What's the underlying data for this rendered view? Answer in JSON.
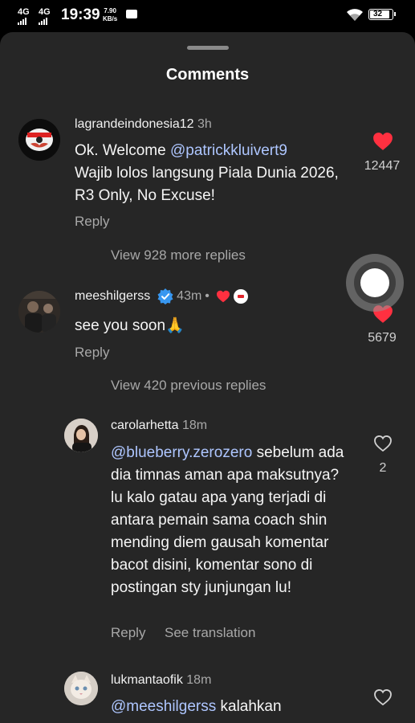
{
  "status_bar": {
    "net1": "4G",
    "net2": "4G",
    "time": "19:39",
    "speed_value": "7.90",
    "speed_unit": "KB/s",
    "battery": "32",
    "icons": [
      "signal-icon",
      "mail-icon",
      "wifi-icon",
      "battery-icon"
    ]
  },
  "sheet": {
    "title": "Comments"
  },
  "comments": [
    {
      "username": "lagrandeindonesia12",
      "time": "3h",
      "mention": "@patrickkluivert9",
      "text_before": "Ok. Welcome ",
      "text_after": "Wajib lolos langsung Piala Dunia 2026, R3 Only, No Excuse!",
      "reply": "Reply",
      "likes": "12447",
      "liked": true,
      "view_replies": "View 928 more replies"
    },
    {
      "username": "meeshilgerss",
      "time": "43m",
      "verified": true,
      "text": "see you soon🙏",
      "reply": "Reply",
      "likes": "5679",
      "liked": true,
      "view_replies": "View 420 previous replies"
    },
    {
      "username": "carolarhetta",
      "time": "18m",
      "mention": "@blueberry.zerozero",
      "text": "sebelum ada dia timnas aman apa maksutnya? lu kalo gatau apa yang terjadi di antara pemain sama coach shin mending diem gausah komentar bacot disini, komentar sono di postingan sty junjungan lu!",
      "reply": "Reply",
      "see_translation": "See translation",
      "likes": "2",
      "liked": false
    },
    {
      "username": "lukmantaofik",
      "time": "18m",
      "mention": "@meeshilgerss",
      "text": "kalahkan",
      "liked": false
    }
  ],
  "colors": {
    "sheet_bg": "#262626",
    "mention": "#aec6ff",
    "like_red": "#ff3040",
    "verify_blue": "#3897f0",
    "secondary_text": "#a8a8a8"
  }
}
